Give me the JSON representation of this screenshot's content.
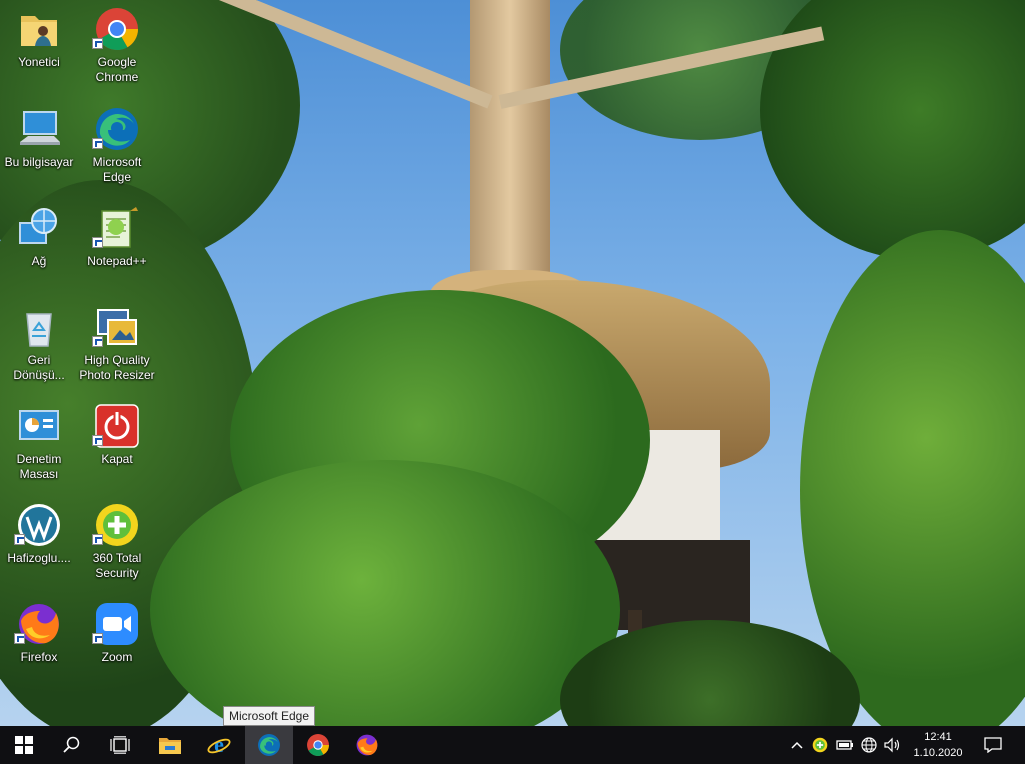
{
  "desktop_icons": [
    {
      "label": "Yonetici"
    },
    {
      "label": "Google\nChrome"
    },
    {
      "label": "Bu bilgisayar"
    },
    {
      "label": "Microsoft\nEdge"
    },
    {
      "label": "Ağ"
    },
    {
      "label": "Notepad++"
    },
    {
      "label": "Geri\nDönüşü..."
    },
    {
      "label": "High Quality\nPhoto Resizer"
    },
    {
      "label": "Denetim\nMasası"
    },
    {
      "label": "Kapat"
    },
    {
      "label": "Hafizoglu...."
    },
    {
      "label": "360 Total\nSecurity"
    },
    {
      "label": "Firefox"
    },
    {
      "label": "Zoom"
    }
  ],
  "taskbar": {
    "tooltip": "Microsoft Edge",
    "pinned": [
      "file-explorer-icon",
      "internet-explorer-icon",
      "edge-icon",
      "chrome-icon",
      "firefox-icon"
    ],
    "clock_time": "12:41",
    "clock_date": "1.10.2020"
  },
  "colors": {
    "taskbar": "#0f0f12",
    "sky": "#4d8fd6"
  }
}
